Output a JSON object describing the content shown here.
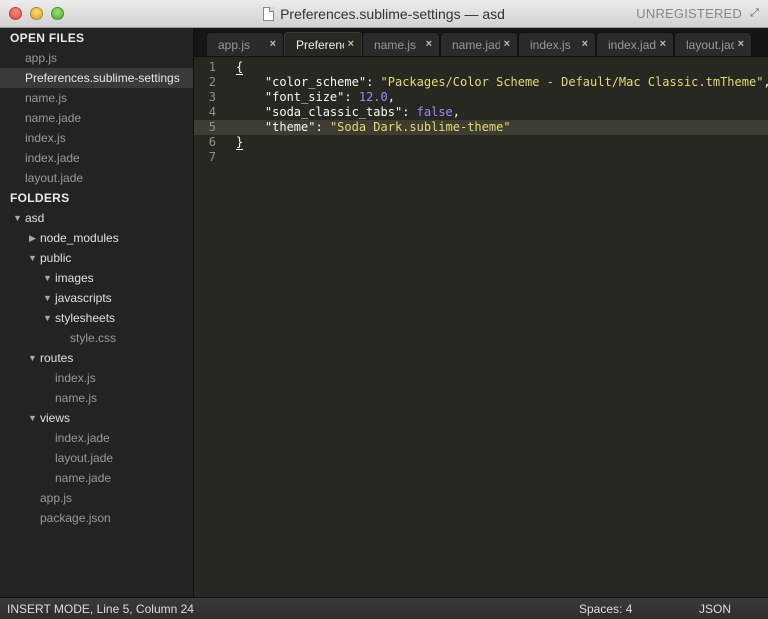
{
  "window": {
    "title": "Preferences.sublime-settings — asd",
    "license_status": "UNREGISTERED"
  },
  "sidebar": {
    "open_files_header": "OPEN FILES",
    "open_files": [
      {
        "label": "app.js",
        "active": false
      },
      {
        "label": "Preferences.sublime-settings",
        "active": true
      },
      {
        "label": "name.js",
        "active": false
      },
      {
        "label": "name.jade",
        "active": false
      },
      {
        "label": "index.js",
        "active": false
      },
      {
        "label": "index.jade",
        "active": false
      },
      {
        "label": "layout.jade",
        "active": false
      }
    ],
    "folders_header": "FOLDERS",
    "tree": [
      {
        "label": "asd",
        "type": "folder",
        "depth": 0,
        "expanded": true
      },
      {
        "label": "node_modules",
        "type": "folder",
        "depth": 1,
        "expanded": false
      },
      {
        "label": "public",
        "type": "folder",
        "depth": 1,
        "expanded": true
      },
      {
        "label": "images",
        "type": "folder",
        "depth": 2,
        "expanded": true
      },
      {
        "label": "javascripts",
        "type": "folder",
        "depth": 2,
        "expanded": true
      },
      {
        "label": "stylesheets",
        "type": "folder",
        "depth": 2,
        "expanded": true
      },
      {
        "label": "style.css",
        "type": "file",
        "depth": 3
      },
      {
        "label": "routes",
        "type": "folder",
        "depth": 1,
        "expanded": true
      },
      {
        "label": "index.js",
        "type": "file",
        "depth": 2
      },
      {
        "label": "name.js",
        "type": "file",
        "depth": 2
      },
      {
        "label": "views",
        "type": "folder",
        "depth": 1,
        "expanded": true
      },
      {
        "label": "index.jade",
        "type": "file",
        "depth": 2
      },
      {
        "label": "layout.jade",
        "type": "file",
        "depth": 2
      },
      {
        "label": "name.jade",
        "type": "file",
        "depth": 2
      },
      {
        "label": "app.js",
        "type": "file",
        "depth": 1
      },
      {
        "label": "package.json",
        "type": "file",
        "depth": 1
      }
    ]
  },
  "tabs": [
    {
      "label": "app.js",
      "active": false
    },
    {
      "label": "Preferences.sublime-settings",
      "active": true
    },
    {
      "label": "name.js",
      "active": false
    },
    {
      "label": "name.jade",
      "active": false
    },
    {
      "label": "index.js",
      "active": false
    },
    {
      "label": "index.jade",
      "active": false
    },
    {
      "label": "layout.jade",
      "active": false
    }
  ],
  "editor": {
    "current_line": 5,
    "lines": [
      {
        "n": "1",
        "t": "{"
      },
      {
        "n": "2",
        "t": "    \"color_scheme\": \"Packages/Color Scheme - Default/Mac Classic.tmTheme\","
      },
      {
        "n": "3",
        "t": "    \"font_size\": 12.0,"
      },
      {
        "n": "4",
        "t": "    \"soda_classic_tabs\": false,"
      },
      {
        "n": "5",
        "t": "    \"theme\": \"Soda Dark.sublime-theme\""
      },
      {
        "n": "6",
        "t": "}"
      },
      {
        "n": "7",
        "t": ""
      }
    ]
  },
  "statusbar": {
    "mode": "INSERT MODE, Line 5, Column 24",
    "indentation": "Spaces: 4",
    "syntax": "JSON"
  },
  "colors": {
    "editor_bg": "#272822",
    "string": "#e6db74",
    "number": "#ae81ff",
    "sidebar_bg": "#232323"
  }
}
